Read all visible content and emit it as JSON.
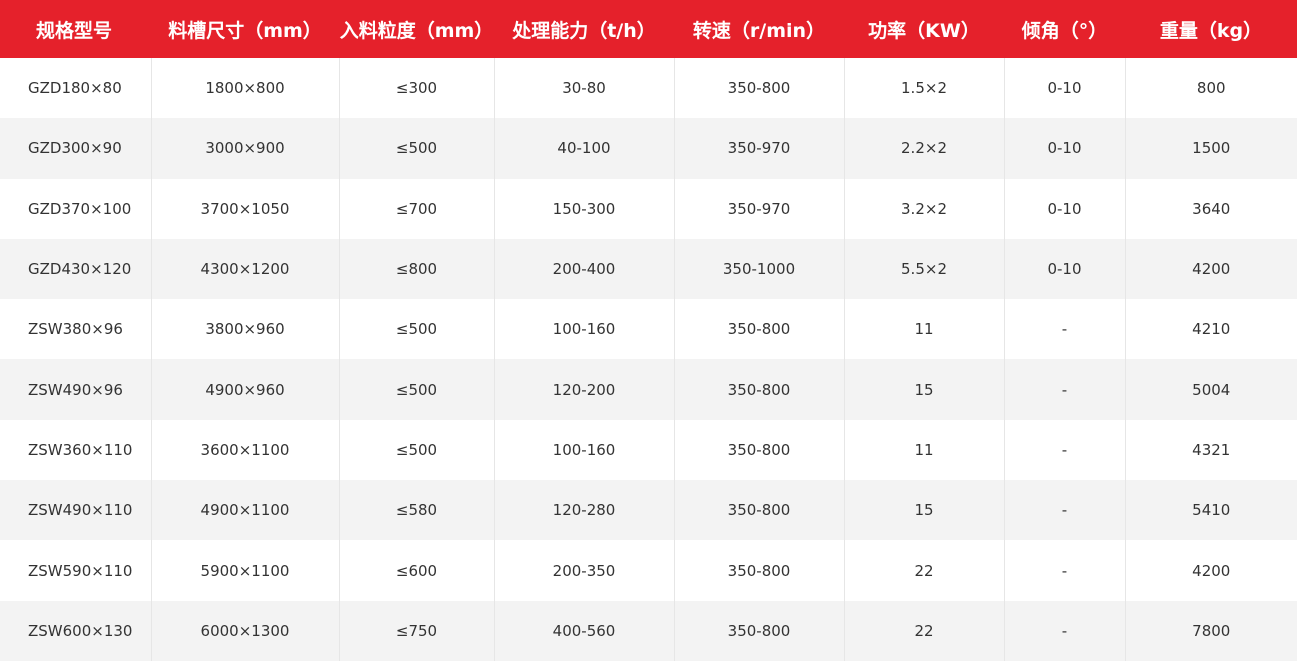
{
  "colors": {
    "header_background": "#e5212b",
    "header_text": "#ffffff",
    "row_alternate": "#f3f3f3",
    "cell_text": "#333333"
  },
  "table": {
    "headers": [
      "规格型号",
      "料槽尺寸（mm）",
      "入料粒度（mm）",
      "处理能力（t/h）",
      "转速（r/min）",
      "功率（KW）",
      "倾角（°）",
      "重量（kg）"
    ],
    "rows": [
      [
        "GZD180×80",
        "1800×800",
        "≤300",
        "30-80",
        "350-800",
        "1.5×2",
        "0-10",
        "800"
      ],
      [
        "GZD300×90",
        "3000×900",
        "≤500",
        "40-100",
        "350-970",
        "2.2×2",
        "0-10",
        "1500"
      ],
      [
        "GZD370×100",
        "3700×1050",
        "≤700",
        "150-300",
        "350-970",
        "3.2×2",
        "0-10",
        "3640"
      ],
      [
        "GZD430×120",
        "4300×1200",
        "≤800",
        "200-400",
        "350-1000",
        "5.5×2",
        "0-10",
        "4200"
      ],
      [
        "ZSW380×96",
        "3800×960",
        "≤500",
        "100-160",
        "350-800",
        "11",
        "-",
        "4210"
      ],
      [
        "ZSW490×96",
        "4900×960",
        "≤500",
        "120-200",
        "350-800",
        "15",
        "-",
        "5004"
      ],
      [
        "ZSW360×110",
        "3600×1100",
        "≤500",
        "100-160",
        "350-800",
        "11",
        "-",
        "4321"
      ],
      [
        "ZSW490×110",
        "4900×1100",
        "≤580",
        "120-280",
        "350-800",
        "15",
        "-",
        "5410"
      ],
      [
        "ZSW590×110",
        "5900×1100",
        "≤600",
        "200-350",
        "350-800",
        "22",
        "-",
        "4200"
      ],
      [
        "ZSW600×130",
        "6000×1300",
        "≤750",
        "400-560",
        "350-800",
        "22",
        "-",
        "7800"
      ]
    ]
  }
}
